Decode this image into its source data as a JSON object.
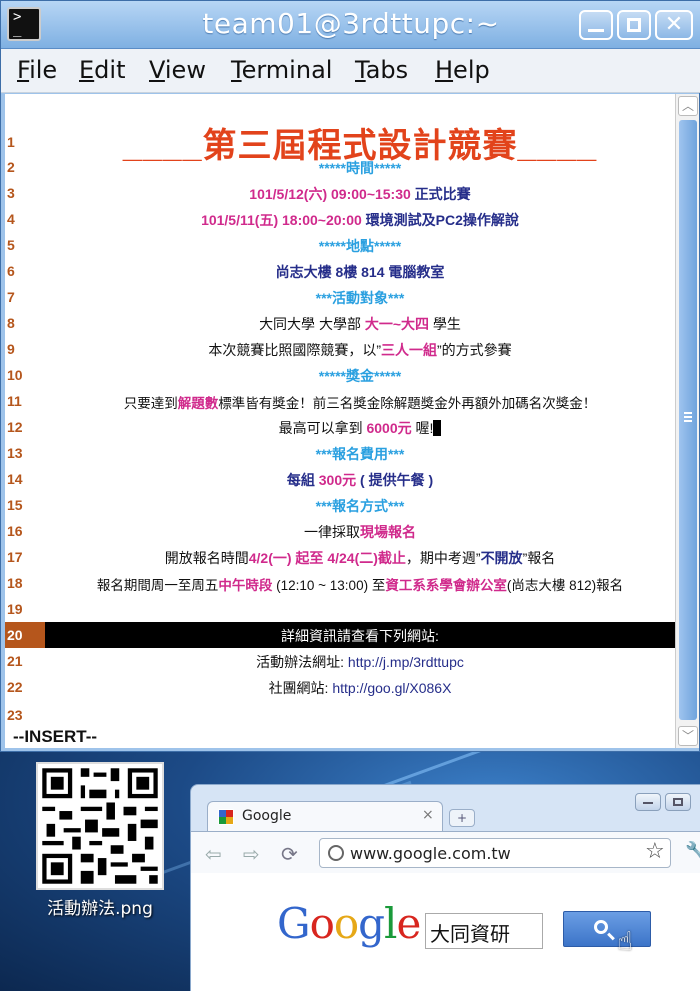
{
  "window": {
    "title": "team01@3rdttupc:~"
  },
  "menu": [
    {
      "key": "F",
      "rest": "ile"
    },
    {
      "key": "E",
      "rest": "dit"
    },
    {
      "key": "V",
      "rest": "iew"
    },
    {
      "key": "T",
      "rest": "erminal"
    },
    {
      "key": "T",
      "rest": "abs"
    },
    {
      "key": "H",
      "rest": "elp"
    }
  ],
  "lines": {
    "l1": {
      "num": "1",
      "text": "____第三屆程式設計競賽____"
    },
    "l2": {
      "num": "2",
      "text": "*****時間*****"
    },
    "l3": {
      "num": "3",
      "a": "101/5/12(六) 09:00~15:30",
      "b": "  正式比賽"
    },
    "l4": {
      "num": "4",
      "a": "101/5/11(五) 18:00~20:00",
      "b": "  環境測試及PC2操作解說"
    },
    "l5": {
      "num": "5",
      "text": "*****地點*****"
    },
    "l6": {
      "num": "6",
      "text": "尚志大樓 8樓 814 電腦教室"
    },
    "l7": {
      "num": "7",
      "text": "***活動對象***"
    },
    "l8": {
      "num": "8",
      "a": "大同大學 大學部 ",
      "b": "大一~大四",
      "c": " 學生"
    },
    "l9": {
      "num": "9",
      "a": "本次競賽比照國際競賽，以”",
      "b": "三人一組",
      "c": "”的方式參賽"
    },
    "l10": {
      "num": "10",
      "text": "*****獎金*****"
    },
    "l11": {
      "num": "11",
      "a": "只要達到",
      "b": "解題數",
      "c": "標準皆有獎金！前三名獎金除解題獎金外再額外加碼名次獎金！"
    },
    "l12": {
      "num": "12",
      "a": "最高可以拿到 ",
      "b": "6000元",
      "c": " 喔!"
    },
    "l13": {
      "num": "13",
      "text": "***報名費用***"
    },
    "l14": {
      "num": "14",
      "a": "每組 ",
      "b": "300元",
      "c": " ( 提供午餐 )"
    },
    "l15": {
      "num": "15",
      "text": "***報名方式***"
    },
    "l16": {
      "num": "16",
      "a": "一律採取",
      "b": "現場報名"
    },
    "l17": {
      "num": "17",
      "a": "開放報名時間",
      "b": "4/2(一) 起至 4/24(二)截止",
      "c": "，期中考週”",
      "d": "不開放",
      "e": "”報名"
    },
    "l18": {
      "num": "18",
      "a": "報名期間周一至周五",
      "b": "中午時段",
      "c": " (12:10 ~ 13:00) 至",
      "d": "資工系系學會辦公室",
      "e": "(尚志大樓 812)報名"
    },
    "l19": {
      "num": "19",
      "text": ""
    },
    "l20": {
      "num": "20",
      "text": "詳細資訊請查看下列網站:"
    },
    "l21": {
      "num": "21",
      "a": "活動辦法網址:   ",
      "b": "http://j.mp/3rdttupc"
    },
    "l22": {
      "num": "22",
      "a": "社團網站:   ",
      "b": "http://goo.gl/X086X"
    },
    "l23": {
      "num": "23",
      "text": ""
    }
  },
  "mode": "--INSERT--",
  "desktop": {
    "qr_label": "活動辦法.png"
  },
  "browser": {
    "tab_title": "Google",
    "tab_close": "×",
    "new_tab": "+",
    "url": "www.google.com.tw",
    "logo": {
      "G": "G",
      "o1": "o",
      "o2": "o",
      "g": "g",
      "l": "l",
      "e": "e"
    },
    "search_value": "大同資研"
  },
  "colors": {
    "accent_pink": "#d02a8c",
    "accent_blue": "#2aa0e0",
    "navy": "#262e8a",
    "title_red": "#e2431b",
    "line_number": "#b5561c"
  }
}
